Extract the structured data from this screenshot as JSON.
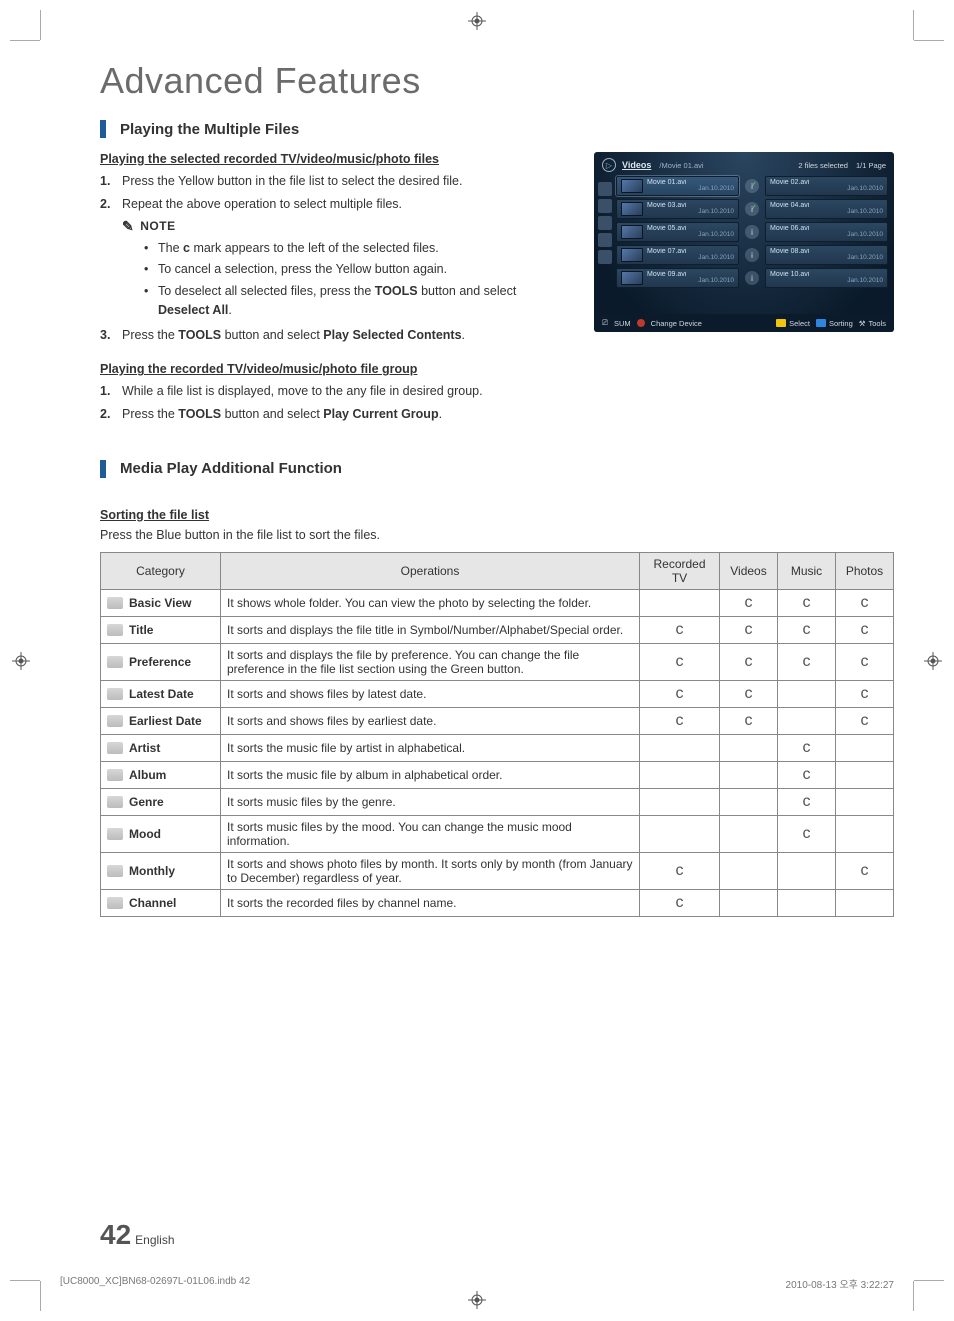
{
  "page": {
    "title": "Advanced Features",
    "number": "42",
    "lang": "English"
  },
  "section1": {
    "title": "Playing the Multiple Files",
    "sub1": {
      "heading": "Playing the selected recorded TV/video/music/photo files",
      "step1_n": "1.",
      "step1": "Press the Yellow button in the file list to select the desired file.",
      "step2_n": "2.",
      "step2": "Repeat the above operation to select multiple files.",
      "note_label": "NOTE",
      "bullet1a": "The ",
      "bullet1b": " mark appears to the left of the selected files.",
      "bullet2": "To cancel a selection, press the Yellow button again.",
      "bullet3a": "To deselect all selected files, press the ",
      "bullet3b": "TOOLS",
      "bullet3c": " button and select ",
      "bullet3d": "Deselect All",
      "bullet3e": ".",
      "step3_n": "3.",
      "step3a": "Press the ",
      "step3b": "TOOLS",
      "step3c": " button and select ",
      "step3d": "Play Selected Contents",
      "step3e": "."
    },
    "sub2": {
      "heading": "Playing the recorded TV/video/music/photo file group",
      "step1_n": "1.",
      "step1": "While a file list is displayed, move to the any file in desired group.",
      "step2_n": "2.",
      "step2a": "Press the ",
      "step2b": "TOOLS",
      "step2c": " button and select ",
      "step2d": "Play Current Group",
      "step2e": "."
    }
  },
  "ui": {
    "tab": "Videos",
    "path": "/Movie 01.avi",
    "selected_count": "2 files selected",
    "page_info": "1/1 Page",
    "files": [
      {
        "name": "Movie 01.avi",
        "date": "Jan.10.2010",
        "checked": true
      },
      {
        "name": "Movie 02.avi",
        "date": "Jan.10.2010",
        "checked": false
      },
      {
        "name": "Movie 03.avi",
        "date": "Jan.10.2010",
        "checked": true
      },
      {
        "name": "Movie 04.avi",
        "date": "Jan.10.2010",
        "checked": false
      },
      {
        "name": "Movie 05.avi",
        "date": "Jan.10.2010",
        "checked": false
      },
      {
        "name": "Movie 06.avi",
        "date": "Jan.10.2010",
        "checked": false
      },
      {
        "name": "Movie 07.avi",
        "date": "Jan.10.2010",
        "checked": false
      },
      {
        "name": "Movie 08.avi",
        "date": "Jan.10.2010",
        "checked": false
      },
      {
        "name": "Movie 09.avi",
        "date": "Jan.10.2010",
        "checked": false
      },
      {
        "name": "Movie 10.avi",
        "date": "Jan.10.2010",
        "checked": false
      }
    ],
    "footer": {
      "sum": "SUM",
      "change": "Change Device",
      "select": "Select",
      "sorting": "Sorting",
      "tools": "Tools"
    }
  },
  "section2": {
    "title": "Media Play Additional Function",
    "sort_heading": "Sorting the file list",
    "sort_desc": "Press the Blue button in the file list to sort the files.",
    "headers": {
      "cat": "Category",
      "ops": "Operations",
      "rec": "Recorded TV",
      "vid": "Videos",
      "mus": "Music",
      "pho": "Photos"
    },
    "rows": [
      {
        "cat": "Basic View",
        "ops": "It shows whole folder. You can view the photo by selecting the folder.",
        "rec": "",
        "vid": "c",
        "mus": "c",
        "pho": "c"
      },
      {
        "cat": "Title",
        "ops": "It sorts and displays the file title in Symbol/Number/Alphabet/Special order.",
        "rec": "c",
        "vid": "c",
        "mus": "c",
        "pho": "c"
      },
      {
        "cat": "Preference",
        "ops": "It sorts and displays the file by preference. You can change the file preference in the file list section using the Green button.",
        "rec": "c",
        "vid": "c",
        "mus": "c",
        "pho": "c"
      },
      {
        "cat": "Latest Date",
        "ops": "It sorts and shows files by latest date.",
        "rec": "c",
        "vid": "c",
        "mus": "",
        "pho": "c"
      },
      {
        "cat": "Earliest Date",
        "ops": "It sorts and shows files by earliest date.",
        "rec": "c",
        "vid": "c",
        "mus": "",
        "pho": "c"
      },
      {
        "cat": "Artist",
        "ops": "It sorts the music file by artist in alphabetical.",
        "rec": "",
        "vid": "",
        "mus": "c",
        "pho": ""
      },
      {
        "cat": "Album",
        "ops": "It sorts the music file by album in alphabetical order.",
        "rec": "",
        "vid": "",
        "mus": "c",
        "pho": ""
      },
      {
        "cat": "Genre",
        "ops": "It sorts music files by the genre.",
        "rec": "",
        "vid": "",
        "mus": "c",
        "pho": ""
      },
      {
        "cat": "Mood",
        "ops": "It sorts music files by the mood. You can change the music mood information.",
        "rec": "",
        "vid": "",
        "mus": "c",
        "pho": ""
      },
      {
        "cat": "Monthly",
        "ops": "It sorts and shows photo files by month. It sorts only by month (from January to December) regardless of year.",
        "rec": "c",
        "vid": "",
        "mus": "",
        "pho": "c"
      },
      {
        "cat": "Channel",
        "ops": "It sorts the recorded files by channel name.",
        "rec": "c",
        "vid": "",
        "mus": "",
        "pho": ""
      }
    ]
  },
  "footer_meta": {
    "left": "[UC8000_XC]BN68-02697L-01L06.indb   42",
    "right": "2010-08-13   오후 3:22:27"
  }
}
